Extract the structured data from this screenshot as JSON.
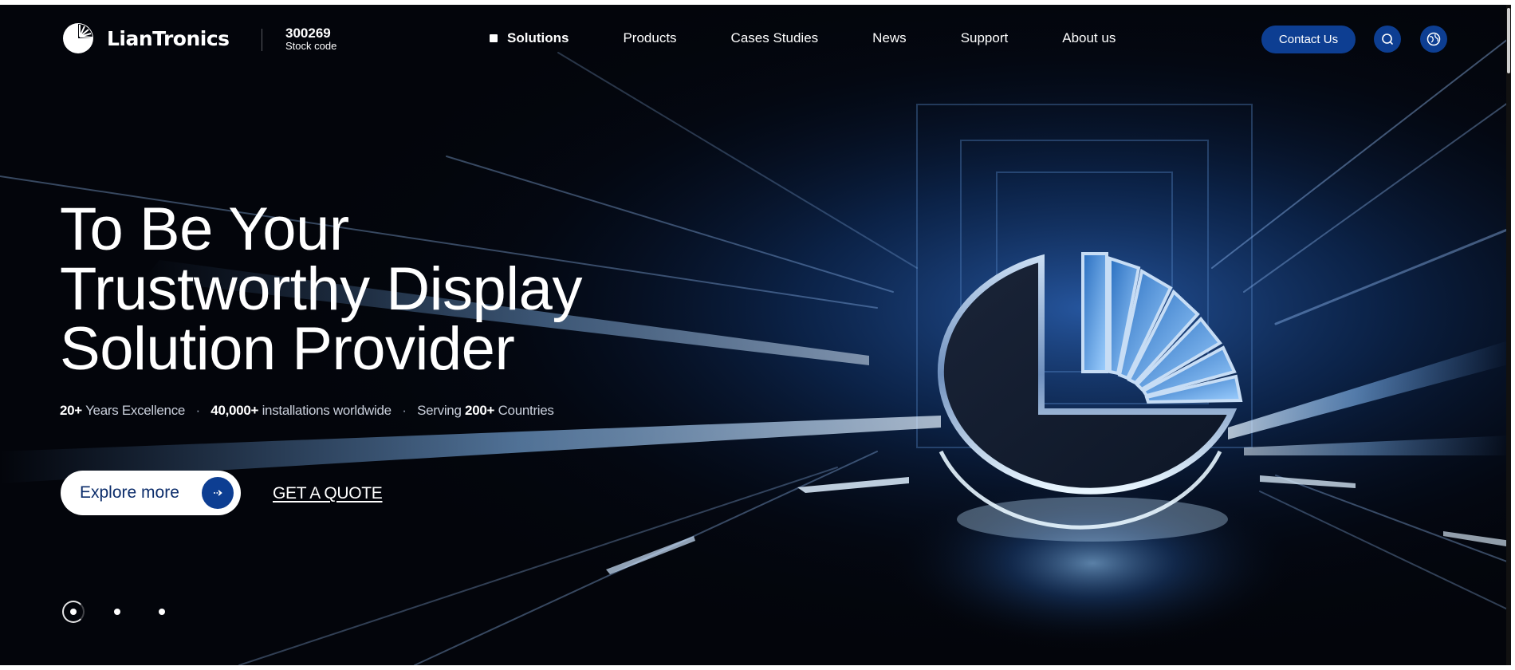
{
  "brand": {
    "name": "LianTronics",
    "stock_code": "300269",
    "stock_label": "Stock code"
  },
  "nav": {
    "items": [
      {
        "label": "Solutions",
        "active": true
      },
      {
        "label": "Products"
      },
      {
        "label": "Cases Studies"
      },
      {
        "label": "News"
      },
      {
        "label": "Support"
      },
      {
        "label": "About us"
      }
    ]
  },
  "header_actions": {
    "contact_label": "Contact Us",
    "search_icon": "search-icon",
    "language_icon": "globe-icon"
  },
  "hero": {
    "headline_lines": [
      "To Be Your",
      "Trustworthy Display",
      "Solution Provider"
    ],
    "stats": {
      "years_value": "20+",
      "years_text": "Years Excellence",
      "installs_value": "40,000+",
      "installs_text": "installations worldwide",
      "serving_text": "Serving",
      "countries_value": "200+",
      "countries_text": "Countries",
      "separator": "·"
    },
    "explore_label": "Explore more",
    "quote_label": "GET A QUOTE"
  },
  "carousel": {
    "slide_count": 3,
    "active_index": 0
  },
  "colors": {
    "accent": "#0d3e92",
    "background": "#03050b",
    "glow": "#4a8fe0"
  }
}
